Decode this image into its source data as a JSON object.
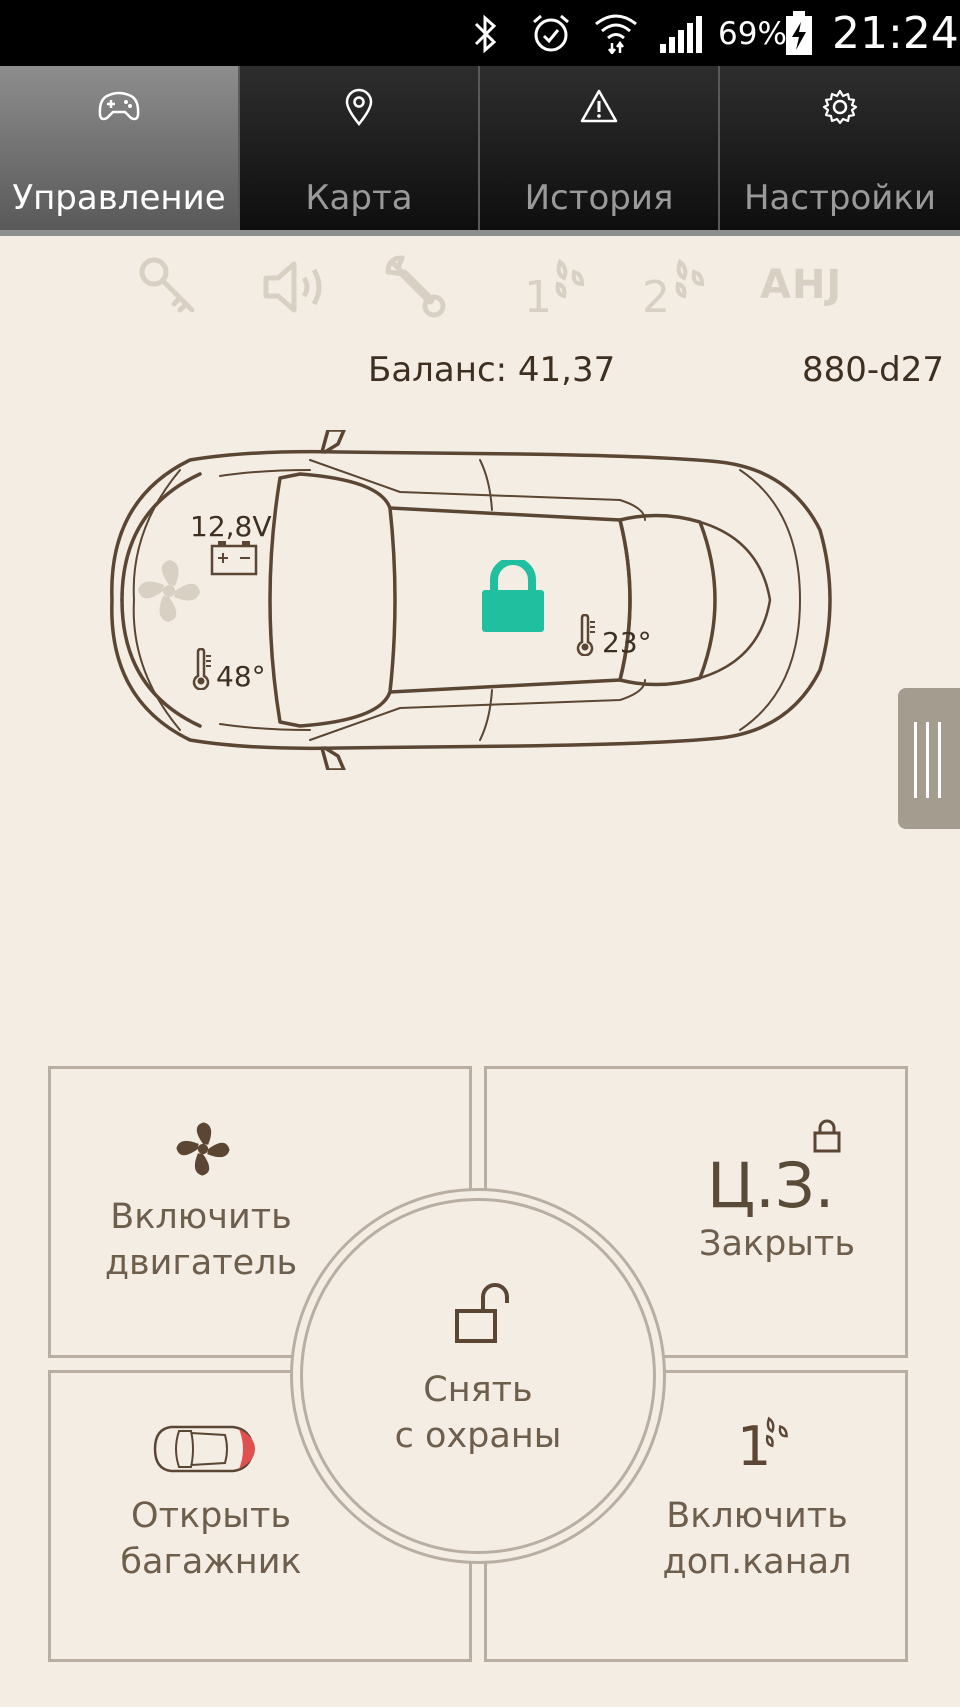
{
  "status_bar": {
    "battery_percent": "69%",
    "time": "21:24",
    "icons": [
      "bluetooth-icon",
      "alarm-icon",
      "wifi-icon",
      "signal-icon",
      "battery-charging-icon"
    ]
  },
  "tabs": [
    {
      "label": "Управление",
      "icon": "gamepad-icon",
      "active": true
    },
    {
      "label": "Карта",
      "icon": "map-pin-icon",
      "active": false
    },
    {
      "label": "История",
      "icon": "warning-icon",
      "active": false
    },
    {
      "label": "Настройки",
      "icon": "gear-icon",
      "active": false
    }
  ],
  "feature_icons": {
    "channel1_digit": "1",
    "channel2_digit": "2",
    "ahj_label": "AHJ"
  },
  "info": {
    "balance": "Баланс: 41,37",
    "device_id": "880-d27"
  },
  "car": {
    "voltage": "12,8V",
    "engine_temp": "48°",
    "cabin_temp": "23°",
    "lock_state": "locked"
  },
  "controls": {
    "engine": {
      "line1": "Включить",
      "line2": "двигатель"
    },
    "central_lock": {
      "title": "Ц.З.",
      "line1": "Закрыть"
    },
    "disarm": {
      "line1": "Снять",
      "line2": "с охраны"
    },
    "trunk": {
      "line1": "Открыть",
      "line2": "багажник"
    },
    "aux_channel": {
      "digit": "1",
      "line1": "Включить",
      "line2": "доп.канал"
    }
  },
  "colors": {
    "background": "#f4ede4",
    "lock_accent": "#1fbf9f",
    "outline": "#5a4633",
    "muted_icon": "#d9d0c4"
  }
}
